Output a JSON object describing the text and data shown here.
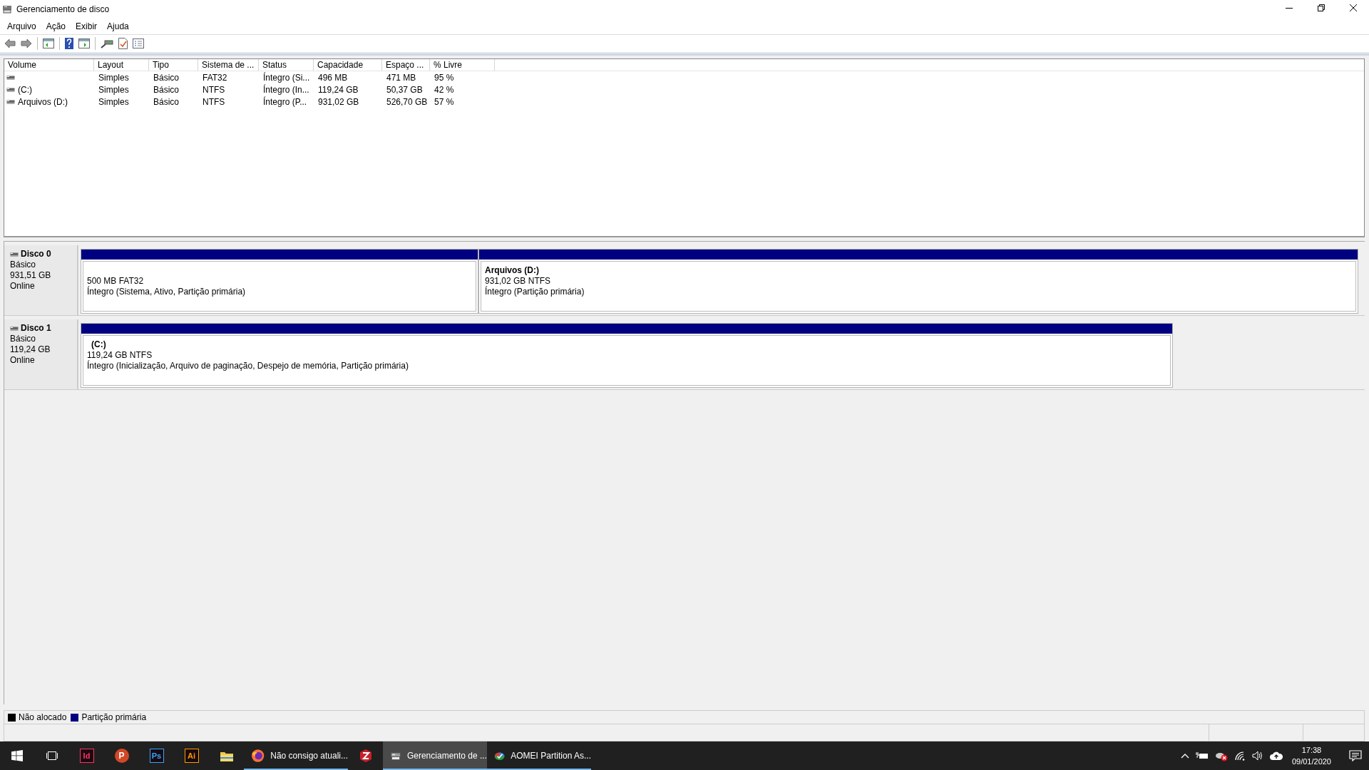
{
  "window": {
    "title": "Gerenciamento de disco"
  },
  "menu": [
    "Arquivo",
    "Ação",
    "Exibir",
    "Ajuda"
  ],
  "table": {
    "columns": [
      "Volume",
      "Layout",
      "Tipo",
      "Sistema de ...",
      "Status",
      "Capacidade",
      "Espaço ...",
      "% Livre"
    ],
    "rows": [
      {
        "cells": [
          "",
          "Simples",
          "Básico",
          "FAT32",
          "Íntegro (Si...",
          "496 MB",
          "471 MB",
          "95 %"
        ]
      },
      {
        "cells": [
          "(C:)",
          "Simples",
          "Básico",
          "NTFS",
          "Íntegro (In...",
          "119,24 GB",
          "50,37 GB",
          "42 %"
        ]
      },
      {
        "cells": [
          "Arquivos (D:)",
          "Simples",
          "Básico",
          "NTFS",
          "Íntegro (P...",
          "931,02 GB",
          "526,70 GB",
          "57 %"
        ]
      }
    ]
  },
  "disks": [
    {
      "name": "Disco 0",
      "type": "Básico",
      "size": "931,51 GB",
      "status": "Online",
      "partitions": [
        {
          "kind": "primary",
          "size_fs": "500 MB FAT32",
          "status": "Íntegro (Sistema, Ativo, Partição primária)"
        },
        {
          "kind": "primary",
          "label": "Arquivos  (D:)",
          "size_fs": "931,02 GB NTFS",
          "status": "Íntegro (Partição primária)"
        }
      ]
    },
    {
      "name": "Disco 1",
      "type": "Básico",
      "size": "119,24 GB",
      "status": "Online",
      "partitions": [
        {
          "kind": "primary",
          "label": "(C:)",
          "size_fs": "119,24 GB NTFS",
          "status": "Íntegro (Inicialização, Arquivo de paginação, Despejo de memória, Partição primária)"
        }
      ]
    }
  ],
  "legend": [
    {
      "label": "Não alocado",
      "color": "#000000"
    },
    {
      "label": "Partição primária",
      "color": "#000080"
    }
  ],
  "taskbar": {
    "apps": [
      {
        "kind": "taskview",
        "selected": false,
        "running": false
      },
      {
        "kind": "logo",
        "glyph": "Id",
        "color": "#ff3366",
        "selected": false,
        "running": false
      },
      {
        "kind": "round",
        "glyph": "P",
        "color": "#d24726",
        "selected": false,
        "running": false
      },
      {
        "kind": "logo",
        "glyph": "Ps",
        "color": "#31a8ff",
        "selected": false,
        "running": false
      },
      {
        "kind": "logo",
        "glyph": "Ai",
        "color": "#ff9a00",
        "selected": false,
        "running": false
      },
      {
        "kind": "folder",
        "selected": false,
        "running": false
      },
      {
        "kind": "firefox",
        "label": "Não consigo atuali...",
        "selected": false,
        "running": true
      },
      {
        "kind": "zip",
        "selected": false,
        "running": false
      },
      {
        "kind": "disk",
        "label": "Gerenciamento de ...",
        "selected": true,
        "running": true
      },
      {
        "kind": "aomei",
        "label": "AOMEI Partition As...",
        "selected": false,
        "running": true
      }
    ],
    "time": "17:38",
    "date": "09/01/2020"
  }
}
